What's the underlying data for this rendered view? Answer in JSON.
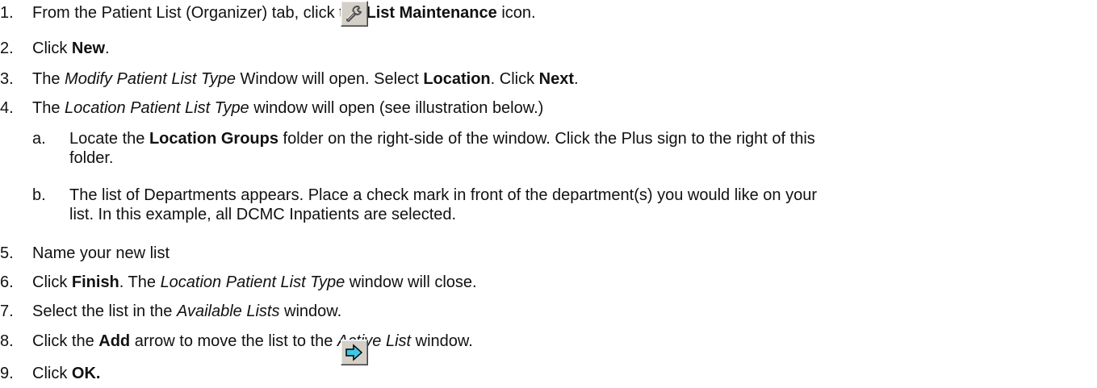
{
  "steps": [
    {
      "num": "1.",
      "pre": "From the Patient List (Organizer) tab, click the ",
      "bold": "List Maintenance",
      "post": " icon."
    },
    {
      "num": "2.",
      "pre": "Click ",
      "bold": "New",
      "post": "."
    },
    {
      "num": "3.",
      "pre": "The ",
      "ital": "Modify Patient List Type",
      "mid": " Window will open.  Select ",
      "bold": "Location",
      "mid2": ". Click ",
      "bold2": "Next",
      "post": "."
    },
    {
      "num": "4.",
      "pre": "The ",
      "ital": "Location Patient List Type",
      "post": " window will open (see illustration below.)"
    },
    {
      "num": "a.",
      "pre": "Locate the ",
      "bold": "Location Groups",
      "post": " folder on the right-side of the window.  Click the Plus sign to the right of this",
      "cont": "folder."
    },
    {
      "num": "b.",
      "pre": "The list of Departments appears.  Place a check mark in front of the department(s) you would like on your",
      "cont": "list. In this example, all DCMC Inpatients are selected."
    },
    {
      "num": "5.",
      "pre": "Name your new list"
    },
    {
      "num": "6.",
      "pre": "Click ",
      "bold": "Finish",
      "mid": ". The ",
      "ital": "Location Patient List Type",
      "post": " window will close."
    },
    {
      "num": "7.",
      "pre": "Select the list in the ",
      "ital": "Available Lists",
      "post": " window."
    },
    {
      "num": "8.",
      "pre": "Click the ",
      "bold": "Add",
      "mid": " arrow to move the list to the ",
      "ital": "Active List",
      "post": " window."
    },
    {
      "num": "9.",
      "pre": "Click ",
      "bold": "OK."
    }
  ],
  "icons": {
    "list_maintenance": "wrench-icon",
    "add_arrow": "right-arrow-icon"
  },
  "colors": {
    "arrow_fill": "#39c9e6",
    "button_face": "#d4d0c8"
  }
}
